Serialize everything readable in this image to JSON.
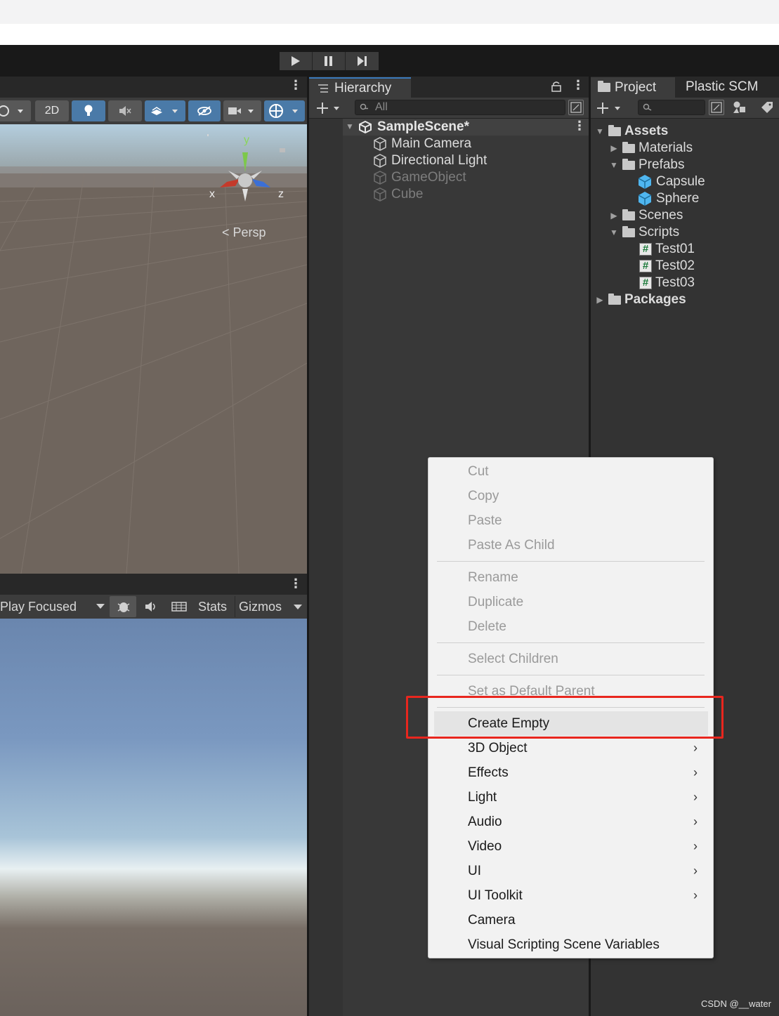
{
  "toolbar": {
    "play_icon": "play-icon",
    "pause_icon": "pause-icon",
    "step_icon": "step-icon"
  },
  "scene": {
    "btn_2d": "2D",
    "persp_label": "Persp",
    "gizmo_axes": {
      "x": "x",
      "y": "y",
      "z": "z"
    }
  },
  "game": {
    "play_focused": "Play Focused",
    "stats": "Stats",
    "gizmos": "Gizmos"
  },
  "hierarchy": {
    "tab_label": "Hierarchy",
    "search_placeholder": "All",
    "scene_name": "SampleScene*",
    "items": [
      {
        "label": "Main Camera",
        "enabled": true
      },
      {
        "label": "Directional Light",
        "enabled": true
      },
      {
        "label": "GameObject",
        "enabled": false
      },
      {
        "label": "Cube",
        "enabled": false
      }
    ]
  },
  "project": {
    "tab_label": "Project",
    "tab2_label": "Plastic SCM",
    "tree": {
      "assets": "Assets",
      "materials": "Materials",
      "prefabs": "Prefabs",
      "capsule": "Capsule",
      "sphere": "Sphere",
      "scenes": "Scenes",
      "scripts": "Scripts",
      "test01": "Test01",
      "test02": "Test02",
      "test03": "Test03",
      "packages": "Packages"
    }
  },
  "context_menu": {
    "cut": "Cut",
    "copy": "Copy",
    "paste": "Paste",
    "paste_as_child": "Paste As Child",
    "rename": "Rename",
    "duplicate": "Duplicate",
    "delete": "Delete",
    "select_children": "Select Children",
    "set_default_parent": "Set as Default Parent",
    "create_empty": "Create Empty",
    "obj3d": "3D Object",
    "effects": "Effects",
    "light": "Light",
    "audio": "Audio",
    "video": "Video",
    "ui": "UI",
    "ui_toolkit": "UI Toolkit",
    "camera": "Camera",
    "visual_scripting": "Visual Scripting Scene Variables",
    "submenu_chevron": "›"
  },
  "watermark": "CSDN @__water",
  "colors": {
    "accent": "#3a79bb",
    "highlight_box": "#e8261e"
  }
}
